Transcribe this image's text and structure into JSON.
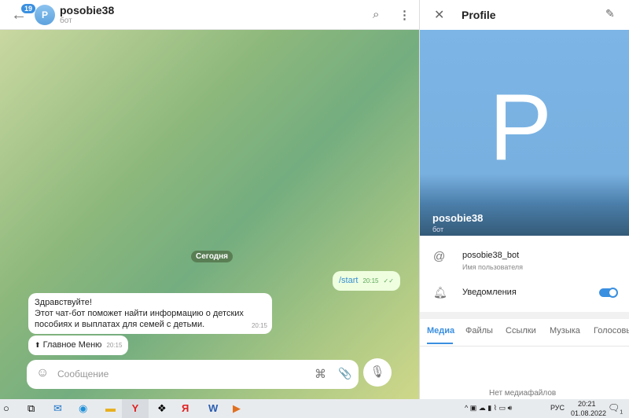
{
  "chat_header": {
    "unread_count": "19",
    "avatar_letter": "P",
    "title": "posobie38",
    "subtitle": "бот"
  },
  "chat": {
    "date_label": "Сегодня",
    "messages": [
      {
        "direction": "out",
        "text": "/start",
        "time": "20:15"
      },
      {
        "direction": "in",
        "lines": [
          "Здравствуйте!",
          "Этот чат-бот поможет найти информацию о детских",
          "пособиях и выплатах для семей с детьми."
        ],
        "time": "20:15"
      },
      {
        "direction": "in",
        "text": "Главное Меню",
        "time": "20:15"
      }
    ],
    "input_placeholder": "Сообщение"
  },
  "profile": {
    "title": "Profile",
    "avatar_letter": "P",
    "name": "posobie38",
    "subtitle": "бот",
    "username": "posobie38_bot",
    "username_label": "Имя пользователя",
    "notifications_label": "Уведомления",
    "notifications_on": true,
    "tabs": [
      "Медиа",
      "Файлы",
      "Ссылки",
      "Музыка",
      "Голосовые"
    ],
    "active_tab": "Медиа",
    "empty_text": "Нет медиафайлов"
  },
  "taskbar": {
    "language": "РУС",
    "time": "20:21",
    "date": "01.08.2022",
    "notification_count": "1"
  },
  "colors": {
    "accent": "#3a8fe0",
    "outgoing_bubble": "#eefedf"
  }
}
